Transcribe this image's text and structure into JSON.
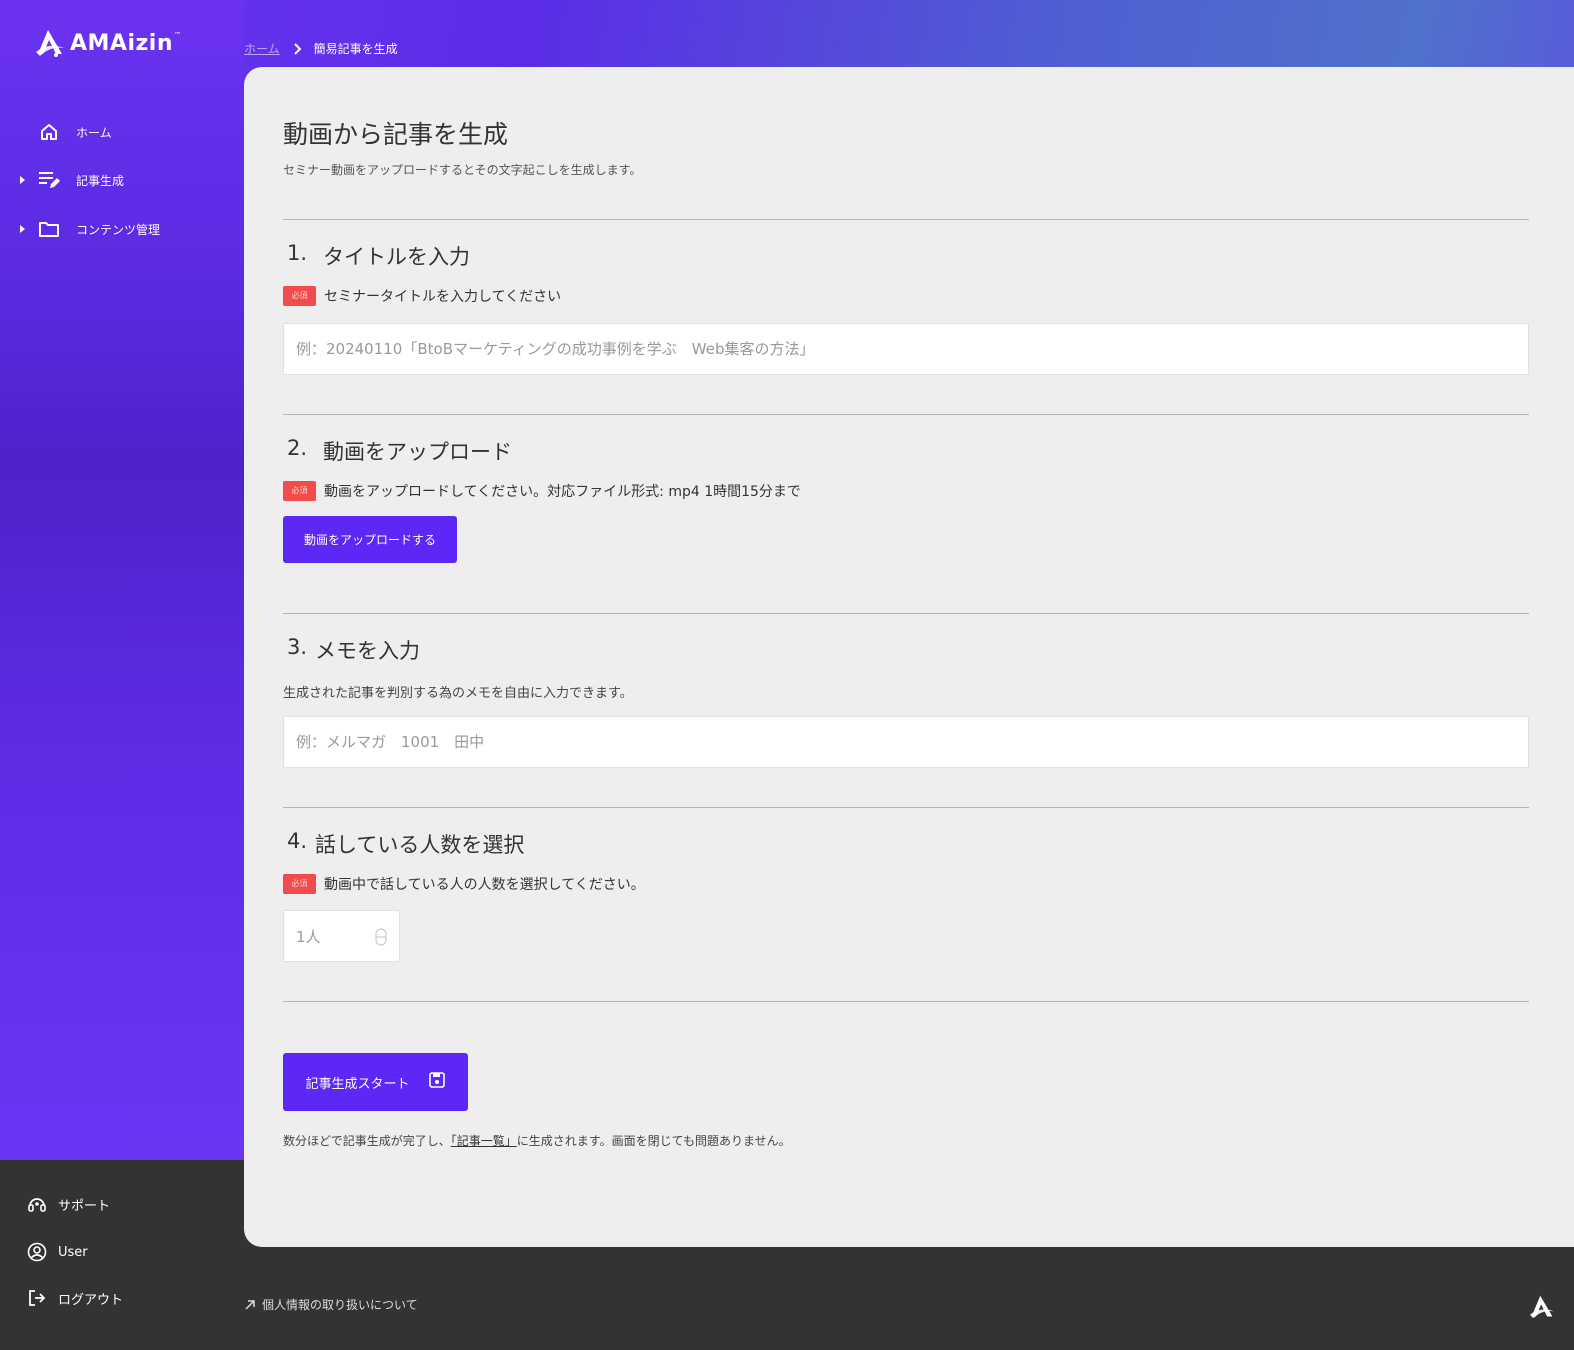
{
  "brand": {
    "name": "AMAizin",
    "trademark": "™"
  },
  "sidebar": {
    "items": [
      {
        "label": "ホーム",
        "icon": "home-icon",
        "expandable": false
      },
      {
        "label": "記事生成",
        "icon": "edit-list-icon",
        "expandable": true
      },
      {
        "label": "コンテンツ管理",
        "icon": "folder-icon",
        "expandable": true
      }
    ],
    "bottom": [
      {
        "label": "サポート",
        "icon": "support-icon"
      },
      {
        "label": "User",
        "icon": "user-icon"
      },
      {
        "label": "ログアウト",
        "icon": "logout-icon"
      }
    ]
  },
  "breadcrumb": {
    "home": "ホーム",
    "current": "簡易記事を生成"
  },
  "page": {
    "title": "動画から記事を生成",
    "description": "セミナー動画をアップロードするとその文字起こしを生成します。"
  },
  "sections": {
    "s1": {
      "num": "1.",
      "title": "タイトルを入力",
      "required_badge": "必須",
      "instruction": "セミナータイトルを入力してください",
      "placeholder": "例：20240110「BtoBマーケティングの成功事例を学ぶ　Web集客の方法」"
    },
    "s2": {
      "num": "2.",
      "title": "動画をアップロード",
      "required_badge": "必須",
      "instruction": "動画をアップロードしてください。対応ファイル形式: mp4 1時間15分まで",
      "button": "動画をアップロードする"
    },
    "s3": {
      "num": "3.",
      "title": "メモを入力",
      "instruction": "生成された記事を判別する為のメモを自由に入力できます。",
      "placeholder": "例：メルマガ　1001　田中"
    },
    "s4": {
      "num": "4.",
      "title": "話している人数を選択",
      "required_badge": "必須",
      "instruction": "動画中で話している人の人数を選択してください。",
      "selected": "1人"
    }
  },
  "submit": {
    "button": "記事生成スタート",
    "note_before": "数分ほどで記事生成が完了し、",
    "note_link": "「記事一覧」",
    "note_after": "に生成されます。画面を閉じても問題ありません。"
  },
  "footer": {
    "privacy_link": "個人情報の取り扱いについて"
  },
  "colors": {
    "primary": "#5d27f5",
    "required": "#f24b4b",
    "card_bg": "#eeeeee",
    "footer_bg": "#333333"
  }
}
